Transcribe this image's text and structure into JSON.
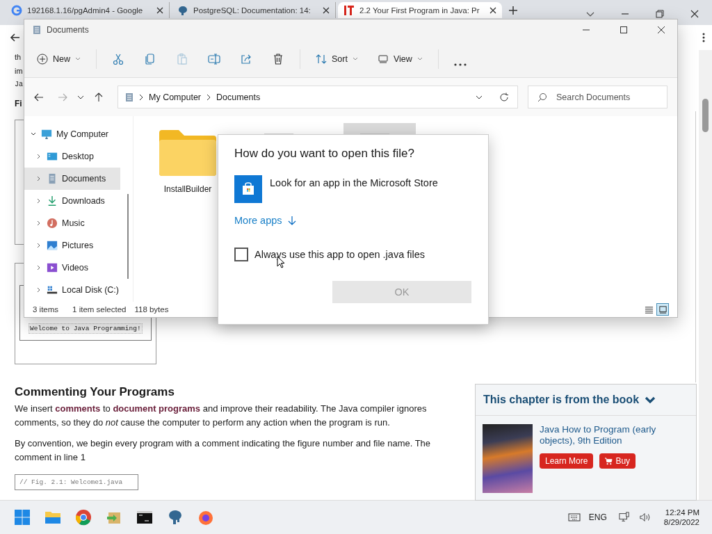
{
  "browser": {
    "tabs": [
      {
        "title": "192168.1.16/pgAdmin4 - Google",
        "selected": false
      },
      {
        "title": "PostgreSQL: Documentation: 14:",
        "selected": false
      },
      {
        "title": "2.2 Your First Program in Java: Pr",
        "selected": true
      }
    ]
  },
  "page": {
    "fragments": [
      "th",
      "im",
      "Ja"
    ],
    "heading_fragment": "Fi",
    "output_text": "Welcome to Java Programming!",
    "section_title": "Commenting Your Programs",
    "paragraphs": [
      "We insert **comments** to **document programs** and improve their readability. The Java compiler ignores comments, so they do *not* cause the computer to perform any action when the program is run.",
      "By convention, we begin every program with a comment indicating the figure number and file name. The comment in line 1"
    ],
    "code": "// Fig. 2.1: Welcome1.java",
    "book_panel": {
      "title": "This chapter is from the book",
      "book_title": "Java How to Program (early objects), 9th Edition",
      "buttons": [
        "Learn More",
        "Buy"
      ]
    }
  },
  "explorer": {
    "title": "Documents",
    "toolbar": {
      "new": "New",
      "sort": "Sort",
      "view": "View",
      "paste_disabled": true
    },
    "nav": {
      "back_disabled": false,
      "forward_disabled": true
    },
    "breadcrumb": [
      "My Computer",
      "Documents"
    ],
    "search": {
      "placeholder": "Search Documents"
    },
    "tree": [
      {
        "label": "My Computer",
        "expanded": true,
        "selected": false,
        "children": [
          {
            "label": "Desktop",
            "expanded": false,
            "selected": false
          },
          {
            "label": "Documents",
            "expanded": false,
            "selected": true
          },
          {
            "label": "Downloads",
            "expanded": false,
            "selected": false
          },
          {
            "label": "Music",
            "expanded": false,
            "selected": false
          },
          {
            "label": "Pictures",
            "expanded": false,
            "selected": false
          },
          {
            "label": "Videos",
            "expanded": false,
            "selected": false
          },
          {
            "label": "Local Disk (C:)",
            "expanded": false,
            "selected": false
          }
        ]
      }
    ],
    "files": [
      {
        "name": "InstallBuilder",
        "kind": "folder",
        "selected": false
      },
      {
        "kind": "file",
        "selected": false
      },
      {
        "kind": "file",
        "selected": true
      }
    ],
    "status": {
      "count": "3 items",
      "selection": "1 item selected",
      "size": "118 bytes"
    },
    "view_buttons": [
      {
        "selected": false
      },
      {
        "selected": true
      }
    ]
  },
  "dialog": {
    "title": "How do you want to open this file?",
    "store_option": "Look for an app in the Microsoft Store",
    "more_apps": "More apps",
    "always_use": {
      "label": "Always use this app to open .java files",
      "checked": false
    },
    "ok": {
      "label": "OK",
      "disabled": true
    }
  },
  "taskbar": {
    "language": "ENG",
    "time": "12:24 PM",
    "date": "8/29/2022"
  }
}
